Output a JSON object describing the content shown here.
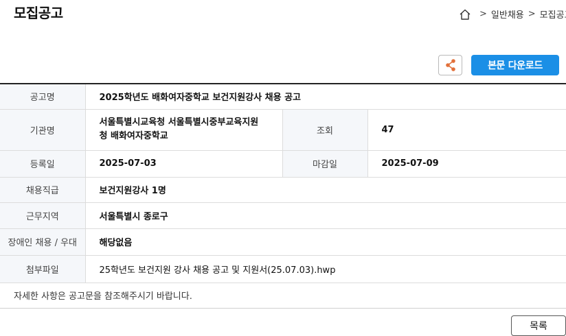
{
  "page": {
    "title": "모집공고"
  },
  "breadcrumb": {
    "items": [
      "일반채용",
      "모집공고"
    ],
    "separator": ">"
  },
  "actions": {
    "share_icon": "share-icon",
    "download_label": "본문 다운로드"
  },
  "table": {
    "title_label": "공고명",
    "title_value": "2025학년도 배화여자중학교 보건지원강사 채용 공고",
    "agency_label": "기관명",
    "agency_line1": "서울특별시교육청 서울특별시중부교육지원",
    "agency_line2": "청 배화여자중학교",
    "views_label": "조회",
    "views_value": "47",
    "registered_label": "등록일",
    "registered_value": "2025-07-03",
    "deadline_label": "마감일",
    "deadline_value": "2025-07-09",
    "position_label": "채용직급",
    "position_value": "보건지원강사 1명",
    "location_label": "근무지역",
    "location_value": "서울특별시 종로구",
    "disability_label": "장애인 채용 / 우대",
    "disability_value": "해당없음",
    "attachment_label": "첨부파일",
    "attachment_value": "25학년도 보건지원 강사 채용 공고 및 지원서(25.07.03).hwp"
  },
  "notice": {
    "text": "자세한 사항은 공고문을 참조해주시기 바랍니다."
  },
  "footer": {
    "list_label": "목록"
  },
  "colors": {
    "accent": "#1b8fe6",
    "share_icon": "#e2703a",
    "label_bg": "#f5f7fa"
  }
}
